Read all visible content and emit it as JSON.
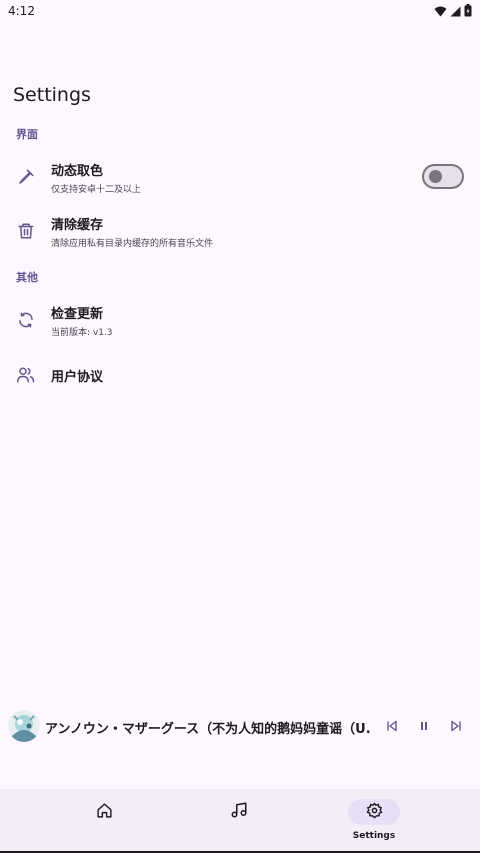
{
  "status_bar": {
    "time": "4:12"
  },
  "page": {
    "title": "Settings"
  },
  "sections": [
    {
      "header": "界面",
      "items": [
        {
          "title": "动态取色",
          "subtitle": "仅支持安卓十二及以上",
          "icon": "eyedropper-icon",
          "toggle": false
        },
        {
          "title": "清除缓存",
          "subtitle": "清除应用私有目录内缓存的所有音乐文件",
          "icon": "trash-icon"
        }
      ]
    },
    {
      "header": "其他",
      "items": [
        {
          "title": "检查更新",
          "subtitle": "当前版本: v1.3",
          "icon": "refresh-icon"
        },
        {
          "title": "用户协议",
          "subtitle": "",
          "icon": "users-icon"
        }
      ]
    }
  ],
  "player": {
    "song_title": "アンノウン・マザーグース（不为人知的鹅妈妈童谣（U...",
    "icons": [
      "skip-previous-icon",
      "pause-icon",
      "skip-next-icon"
    ]
  },
  "nav": {
    "items": [
      {
        "label": "",
        "icon": "home-icon",
        "active": false
      },
      {
        "label": "",
        "icon": "music-note-icon",
        "active": false
      },
      {
        "label": "Settings",
        "icon": "gear-icon",
        "active": true
      }
    ]
  },
  "colors": {
    "background": "#fef7ff",
    "accent": "#65558f",
    "nav_background": "#f3edf7",
    "active_pill": "#e8def8"
  }
}
